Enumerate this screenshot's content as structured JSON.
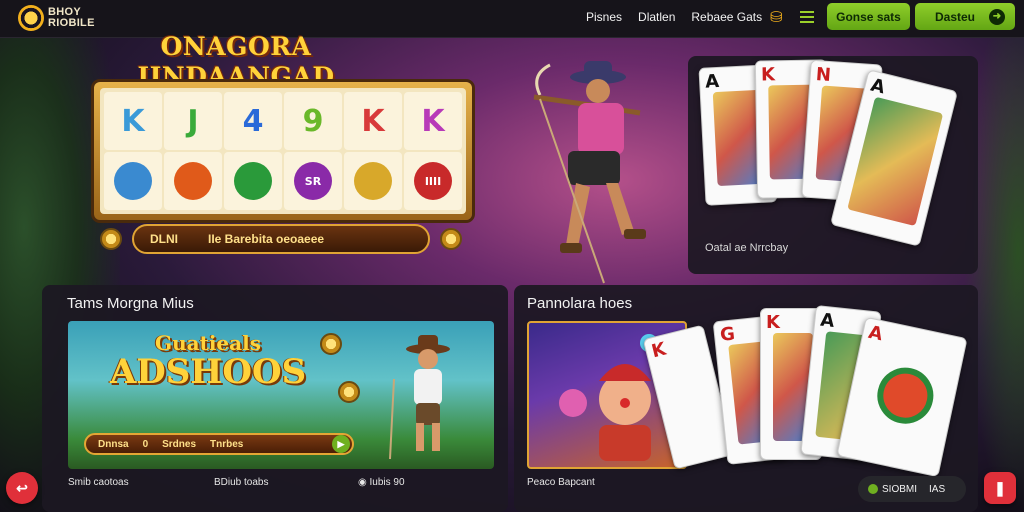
{
  "header": {
    "logo_line1": "BHOY",
    "logo_line2": "RIOBILE",
    "nav": [
      "Pisnes",
      "Dlatlen",
      "Rebaee Gats"
    ],
    "deposit_label": "Gonse sats",
    "login_label": "Dasteu"
  },
  "slot": {
    "title_line1": "ONAGORA",
    "title_line2": "IINDAANGAD",
    "reels_top": [
      "K",
      "J",
      "4",
      "9",
      "K",
      "K"
    ],
    "reels_bottom": [
      "",
      "",
      "",
      "SR",
      "",
      "IIII"
    ],
    "bar_left": "DLNI",
    "bar_right": "IIe Barebita oeoaeee"
  },
  "cards_panel": {
    "caption": "Oatal ae Nrrcbay",
    "cards": [
      {
        "rank": "A",
        "suit": "♠",
        "color": "black"
      },
      {
        "rank": "K",
        "suit": "♥",
        "color": "red"
      },
      {
        "rank": "N",
        "suit": "♥",
        "color": "red"
      },
      {
        "rank": "A",
        "suit": "♠",
        "color": "black"
      }
    ]
  },
  "tm_panel": {
    "title": "Tams Morgna Mius",
    "game_line1": "Guatieals",
    "game_line2": "ADSHOOS",
    "bar_items": [
      "Dnnsa",
      "0",
      "Srdnes",
      "Tnrbes"
    ],
    "meta_left": "Smib caotoas",
    "meta_mid": "BDiub toabs",
    "meta_right": "Iubis 90"
  },
  "pop_panel": {
    "title": "Pannolara hoes",
    "meta_left": "Peaco Bapcant",
    "cards": [
      {
        "rank": "K",
        "suit": "♥"
      },
      {
        "rank": "G",
        "suit": "♥"
      },
      {
        "rank": "K",
        "suit": "♥"
      },
      {
        "rank": "A",
        "suit": "♠"
      },
      {
        "rank": "A",
        "suit": "♥"
      }
    ]
  },
  "footer": {
    "pill_label": "SIOBMI",
    "pill_extra": "IAS"
  },
  "colors": {
    "accent_green": "#8fce2a",
    "accent_red": "#e0303a",
    "gold": "#ffd23a"
  }
}
